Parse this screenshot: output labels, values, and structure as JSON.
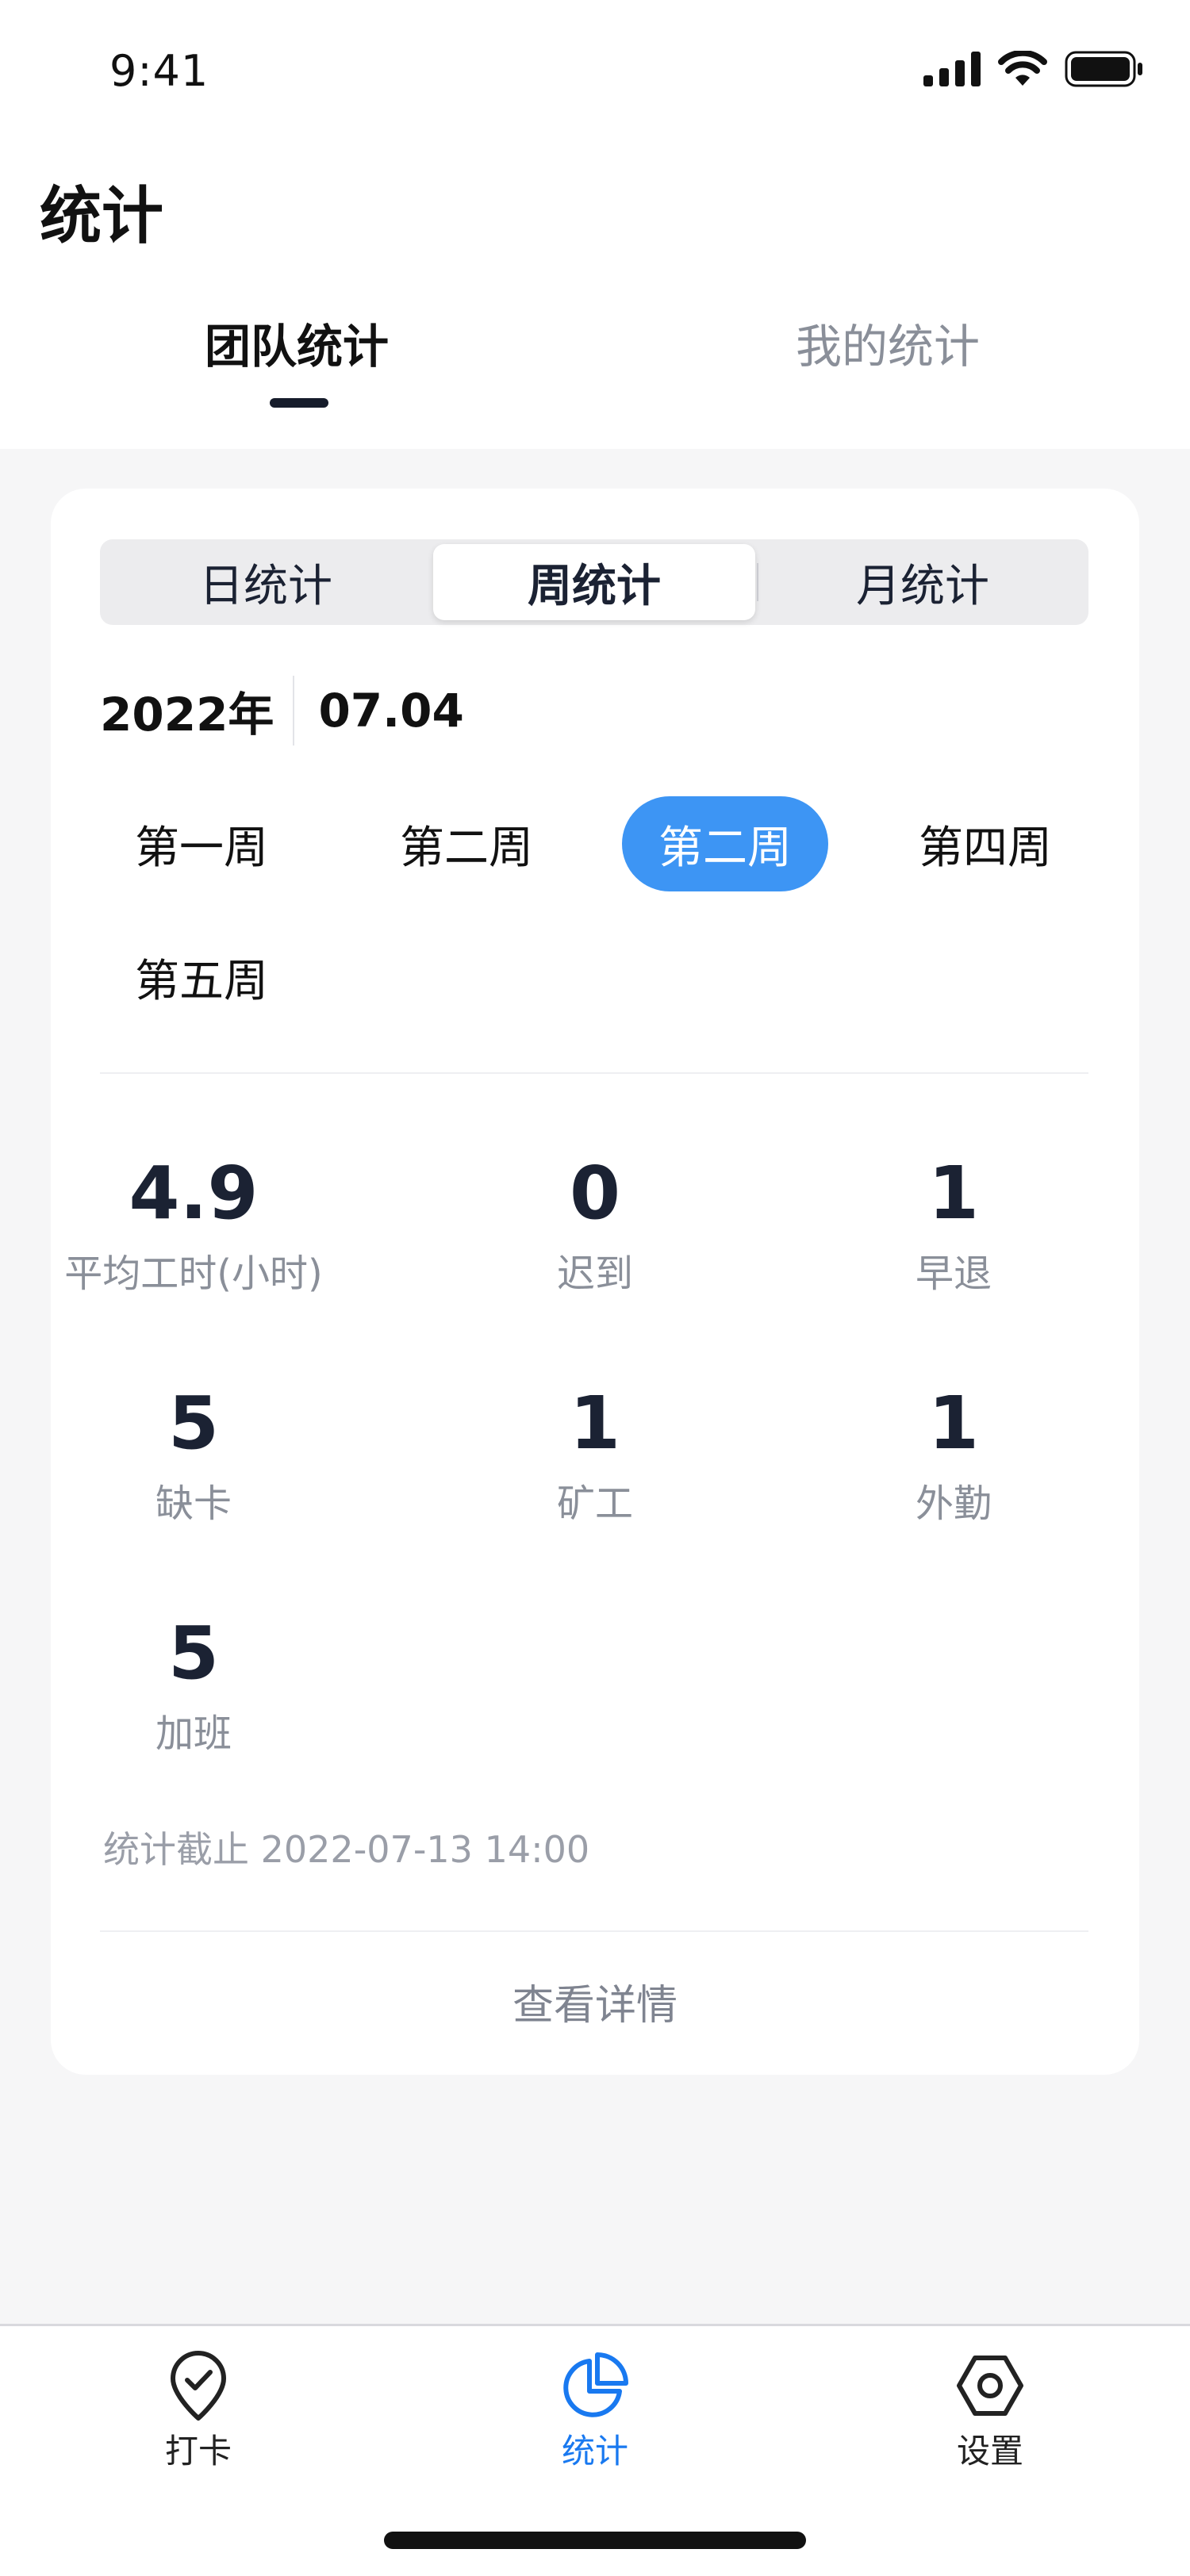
{
  "status_bar": {
    "time": "9:41"
  },
  "header": {
    "title": "统计"
  },
  "top_tabs": [
    {
      "label": "团队统计",
      "active": true
    },
    {
      "label": "我的统计",
      "active": false
    }
  ],
  "segment": {
    "items": [
      {
        "label": "日统计"
      },
      {
        "label": "周统计",
        "selected": true
      },
      {
        "label": "月统计"
      }
    ]
  },
  "date": {
    "year": "2022年",
    "day": "07.04"
  },
  "weeks": [
    {
      "label": "第一周"
    },
    {
      "label": "第二周"
    },
    {
      "label": "第二周",
      "selected": true
    },
    {
      "label": "第四周"
    },
    {
      "label": "第五周"
    }
  ],
  "stats": [
    {
      "value": "4.9",
      "label": "平均工时(小时)"
    },
    {
      "value": "0",
      "label": "迟到"
    },
    {
      "value": "1",
      "label": "早退"
    },
    {
      "value": "5",
      "label": "缺卡"
    },
    {
      "value": "1",
      "label": "矿工"
    },
    {
      "value": "1",
      "label": "外勤"
    },
    {
      "value": "5",
      "label": "加班"
    }
  ],
  "cutoff": "统计截止 2022-07-13 14:00",
  "details_link": "查看详情",
  "bottom_nav": [
    {
      "label": "打卡",
      "icon": "checkin-pin-icon"
    },
    {
      "label": "统计",
      "icon": "pie-chart-icon",
      "active": true
    },
    {
      "label": "设置",
      "icon": "hexagon-settings-icon"
    }
  ],
  "colors": {
    "accent": "#3d95f4",
    "nav_active": "#1979f0",
    "text": "#1b2233",
    "muted": "#8a8f99",
    "background": "#f6f6f7"
  }
}
